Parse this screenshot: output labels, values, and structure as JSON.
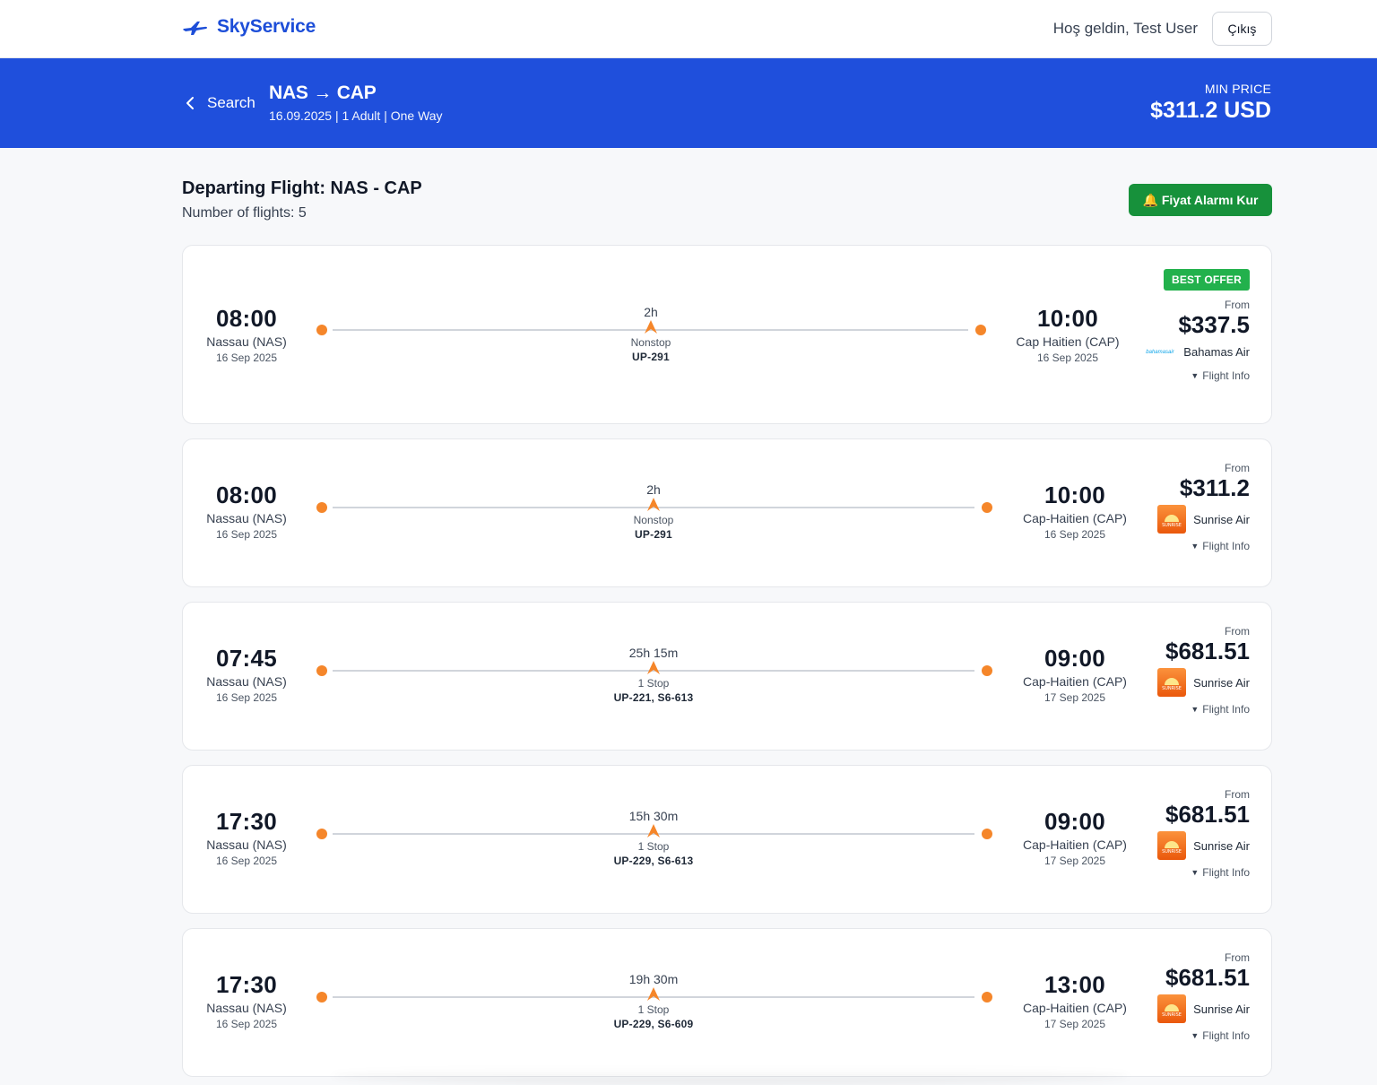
{
  "header": {
    "brand": "SkyService",
    "welcome": "Hoş geldin, Test User",
    "logout_label": "Çıkış"
  },
  "banner": {
    "back_label": "Search",
    "route": "NAS → CAP",
    "subtitle": "16.09.2025 | 1 Adult | One Way",
    "min_price_label": "MIN PRICE",
    "min_price_value": "$311.2 USD"
  },
  "results": {
    "title": "Departing Flight: NAS - CAP",
    "count": "Number of flights: 5",
    "alarm_label": "🔔 Fiyat Alarmı Kur"
  },
  "flights": [
    {
      "badge": "BEST OFFER",
      "dep_time": "08:00",
      "dep_city": "Nassau (NAS)",
      "dep_date": "16 Sep 2025",
      "duration": "2h",
      "stops": "Nonstop",
      "flight_no": "UP-291",
      "arr_time": "10:00",
      "arr_city": "Cap Haitien (CAP)",
      "arr_date": "16 Sep 2025",
      "from_label": "From",
      "price": "$337.5",
      "airline": "Bahamas Air",
      "airline_logo": "bahamasair-logo",
      "info_label": "Flight Info"
    },
    {
      "dep_time": "08:00",
      "dep_city": "Nassau (NAS)",
      "dep_date": "16 Sep 2025",
      "duration": "2h",
      "stops": "Nonstop",
      "flight_no": "UP-291",
      "arr_time": "10:00",
      "arr_city": "Cap-Haitien (CAP)",
      "arr_date": "16 Sep 2025",
      "from_label": "From",
      "price": "$311.2",
      "airline": "Sunrise Air",
      "airline_logo": "sunrise-logo",
      "info_label": "Flight Info"
    },
    {
      "dep_time": "07:45",
      "dep_city": "Nassau (NAS)",
      "dep_date": "16 Sep 2025",
      "duration": "25h 15m",
      "stops": "1 Stop",
      "flight_no": "UP-221, S6-613",
      "arr_time": "09:00",
      "arr_city": "Cap-Haitien (CAP)",
      "arr_date": "17 Sep 2025",
      "from_label": "From",
      "price": "$681.51",
      "airline": "Sunrise Air",
      "airline_logo": "sunrise-logo",
      "info_label": "Flight Info"
    },
    {
      "dep_time": "17:30",
      "dep_city": "Nassau (NAS)",
      "dep_date": "16 Sep 2025",
      "duration": "15h 30m",
      "stops": "1 Stop",
      "flight_no": "UP-229, S6-613",
      "arr_time": "09:00",
      "arr_city": "Cap-Haitien (CAP)",
      "arr_date": "17 Sep 2025",
      "from_label": "From",
      "price": "$681.51",
      "airline": "Sunrise Air",
      "airline_logo": "sunrise-logo",
      "info_label": "Flight Info"
    },
    {
      "dep_time": "17:30",
      "dep_city": "Nassau (NAS)",
      "dep_date": "16 Sep 2025",
      "duration": "19h 30m",
      "stops": "1 Stop",
      "flight_no": "UP-229, S6-609",
      "arr_time": "13:00",
      "arr_city": "Cap-Haitien (CAP)",
      "arr_date": "17 Sep 2025",
      "from_label": "From",
      "price": "$681.51",
      "airline": "Sunrise Air",
      "airline_logo": "sunrise-logo",
      "info_label": "Flight Info"
    }
  ],
  "colors": {
    "brand_blue": "#1d4ed8",
    "banner_blue": "#1f4fdc",
    "accent_orange": "#f5862a",
    "alarm_green": "#17913b",
    "best_offer_green": "#22b14c"
  }
}
